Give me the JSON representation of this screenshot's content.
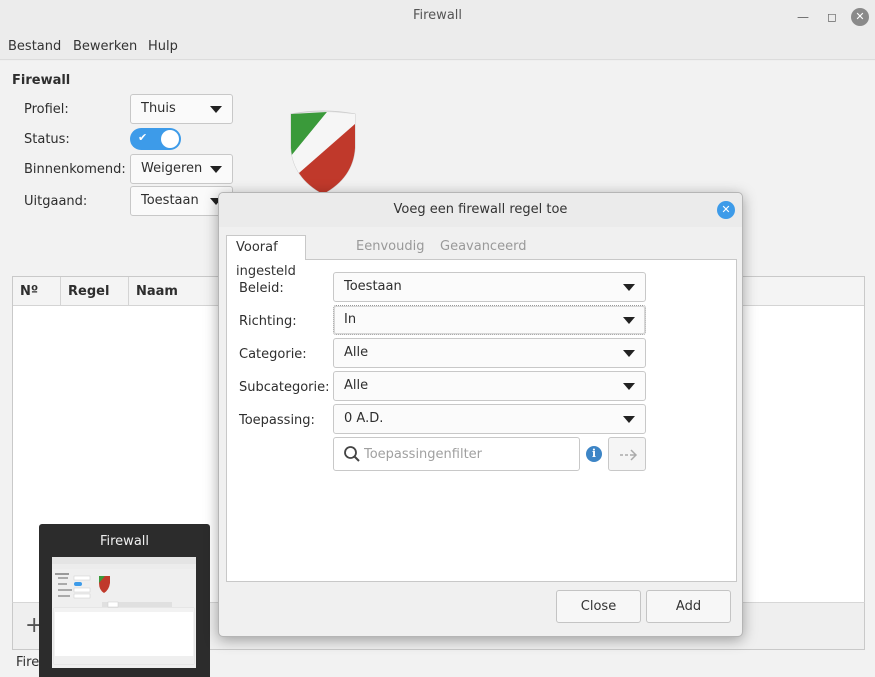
{
  "window": {
    "title": "Firewall",
    "menu": [
      "Bestand",
      "Bewerken",
      "Hulp"
    ]
  },
  "main": {
    "section_title": "Firewall",
    "profile_label": "Profiel:",
    "profile_value": "Thuis",
    "status_label": "Status:",
    "status_on": true,
    "incoming_label": "Binnenkomend:",
    "incoming_value": "Weigeren",
    "outgoing_label": "Uitgaand:",
    "outgoing_value": "Toestaan",
    "table_headers": [
      "Nº",
      "Regel",
      "Naam"
    ],
    "add_button": "+",
    "status_text": "Fire"
  },
  "preview": {
    "title": "Firewall"
  },
  "dialog": {
    "title": "Voeg een firewall regel toe",
    "tabs": [
      "Vooraf ingesteld",
      "Eenvoudig",
      "Geavanceerd"
    ],
    "fields": {
      "policy_label": "Beleid:",
      "policy_value": "Toestaan",
      "direction_label": "Richting:",
      "direction_value": "In",
      "category_label": "Categorie:",
      "category_value": "Alle",
      "subcategory_label": "Subcategorie:",
      "subcategory_value": "Alle",
      "application_label": "Toepassing:",
      "application_value": "0 A.D."
    },
    "search_placeholder": "Toepassingenfilter",
    "close_button": "Close",
    "add_button": "Add"
  },
  "colors": {
    "accent": "#3d9be9",
    "info": "#3d85c6"
  }
}
